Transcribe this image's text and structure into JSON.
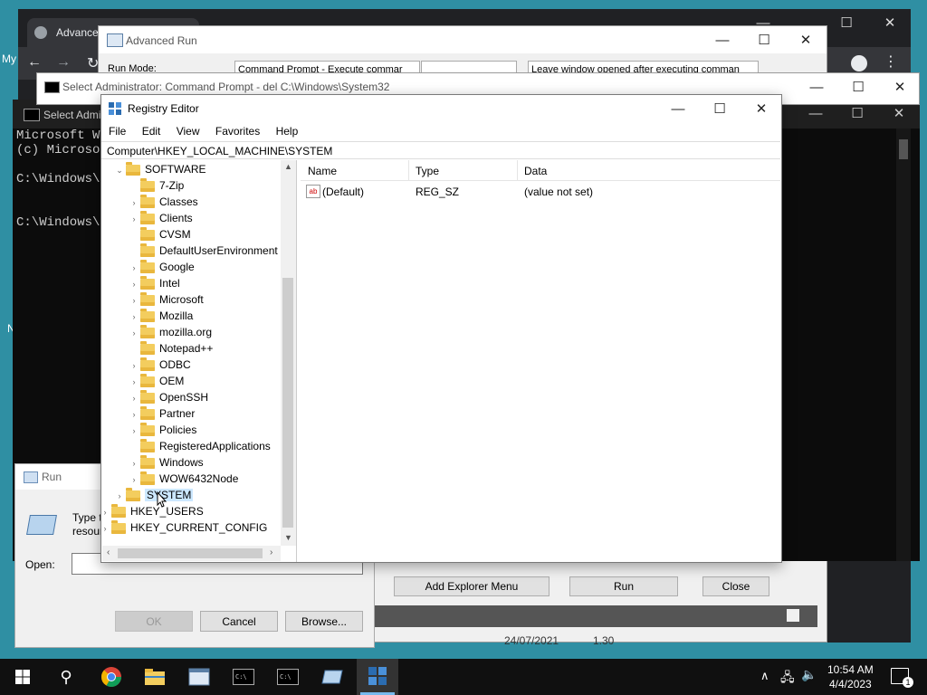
{
  "browser": {
    "tab_title": "Advance"
  },
  "advanced_run": {
    "title": "Advanced Run",
    "run_mode_label": "Run Mode:",
    "run_mode_value": "Command Prompt - Execute commar",
    "window_option": "Leave window opened after executing comman",
    "buttons": {
      "add_explorer_menu": "Add Explorer Menu",
      "run": "Run",
      "close": "Close"
    },
    "row_date": "24/07/2021",
    "row_num": "1.30"
  },
  "cmd_admin": {
    "title": "Select Administrator:  Command Prompt - del  C:\\Windows\\System32"
  },
  "cmd_back": {
    "title": "Select Admi",
    "lines": [
      "Microsoft Wi",
      "(c) Microsof",
      "",
      "C:\\Windows\\sy",
      "",
      "",
      "C:\\Windows\\sy"
    ]
  },
  "registry": {
    "title": "Registry Editor",
    "menu": [
      "File",
      "Edit",
      "View",
      "Favorites",
      "Help"
    ],
    "address": "Computer\\HKEY_LOCAL_MACHINE\\SYSTEM",
    "tree": {
      "software": "SOFTWARE",
      "children": [
        "7-Zip",
        "Classes",
        "Clients",
        "CVSM",
        "DefaultUserEnvironment",
        "Google",
        "Intel",
        "Microsoft",
        "Mozilla",
        "mozilla.org",
        "Notepad++",
        "ODBC",
        "OEM",
        "OpenSSH",
        "Partner",
        "Policies",
        "RegisteredApplications",
        "Windows",
        "WOW6432Node"
      ],
      "system": "SYSTEM",
      "users": "HKEY_USERS",
      "config": "HKEY_CURRENT_CONFIG"
    },
    "columns": {
      "name": "Name",
      "type": "Type",
      "data": "Data"
    },
    "values": [
      {
        "name": "(Default)",
        "type": "REG_SZ",
        "data": "(value not set)"
      }
    ]
  },
  "run_dialog": {
    "title": "Run",
    "desc1": "Type t",
    "desc2": "resour",
    "open_label": "Open:",
    "ok": "OK",
    "cancel": "Cancel",
    "browse": "Browse..."
  },
  "desktop": {
    "label1": "My",
    "label2": "N"
  },
  "taskbar": {
    "time": "10:54 AM",
    "date": "4/4/2023",
    "notifications": "1"
  }
}
